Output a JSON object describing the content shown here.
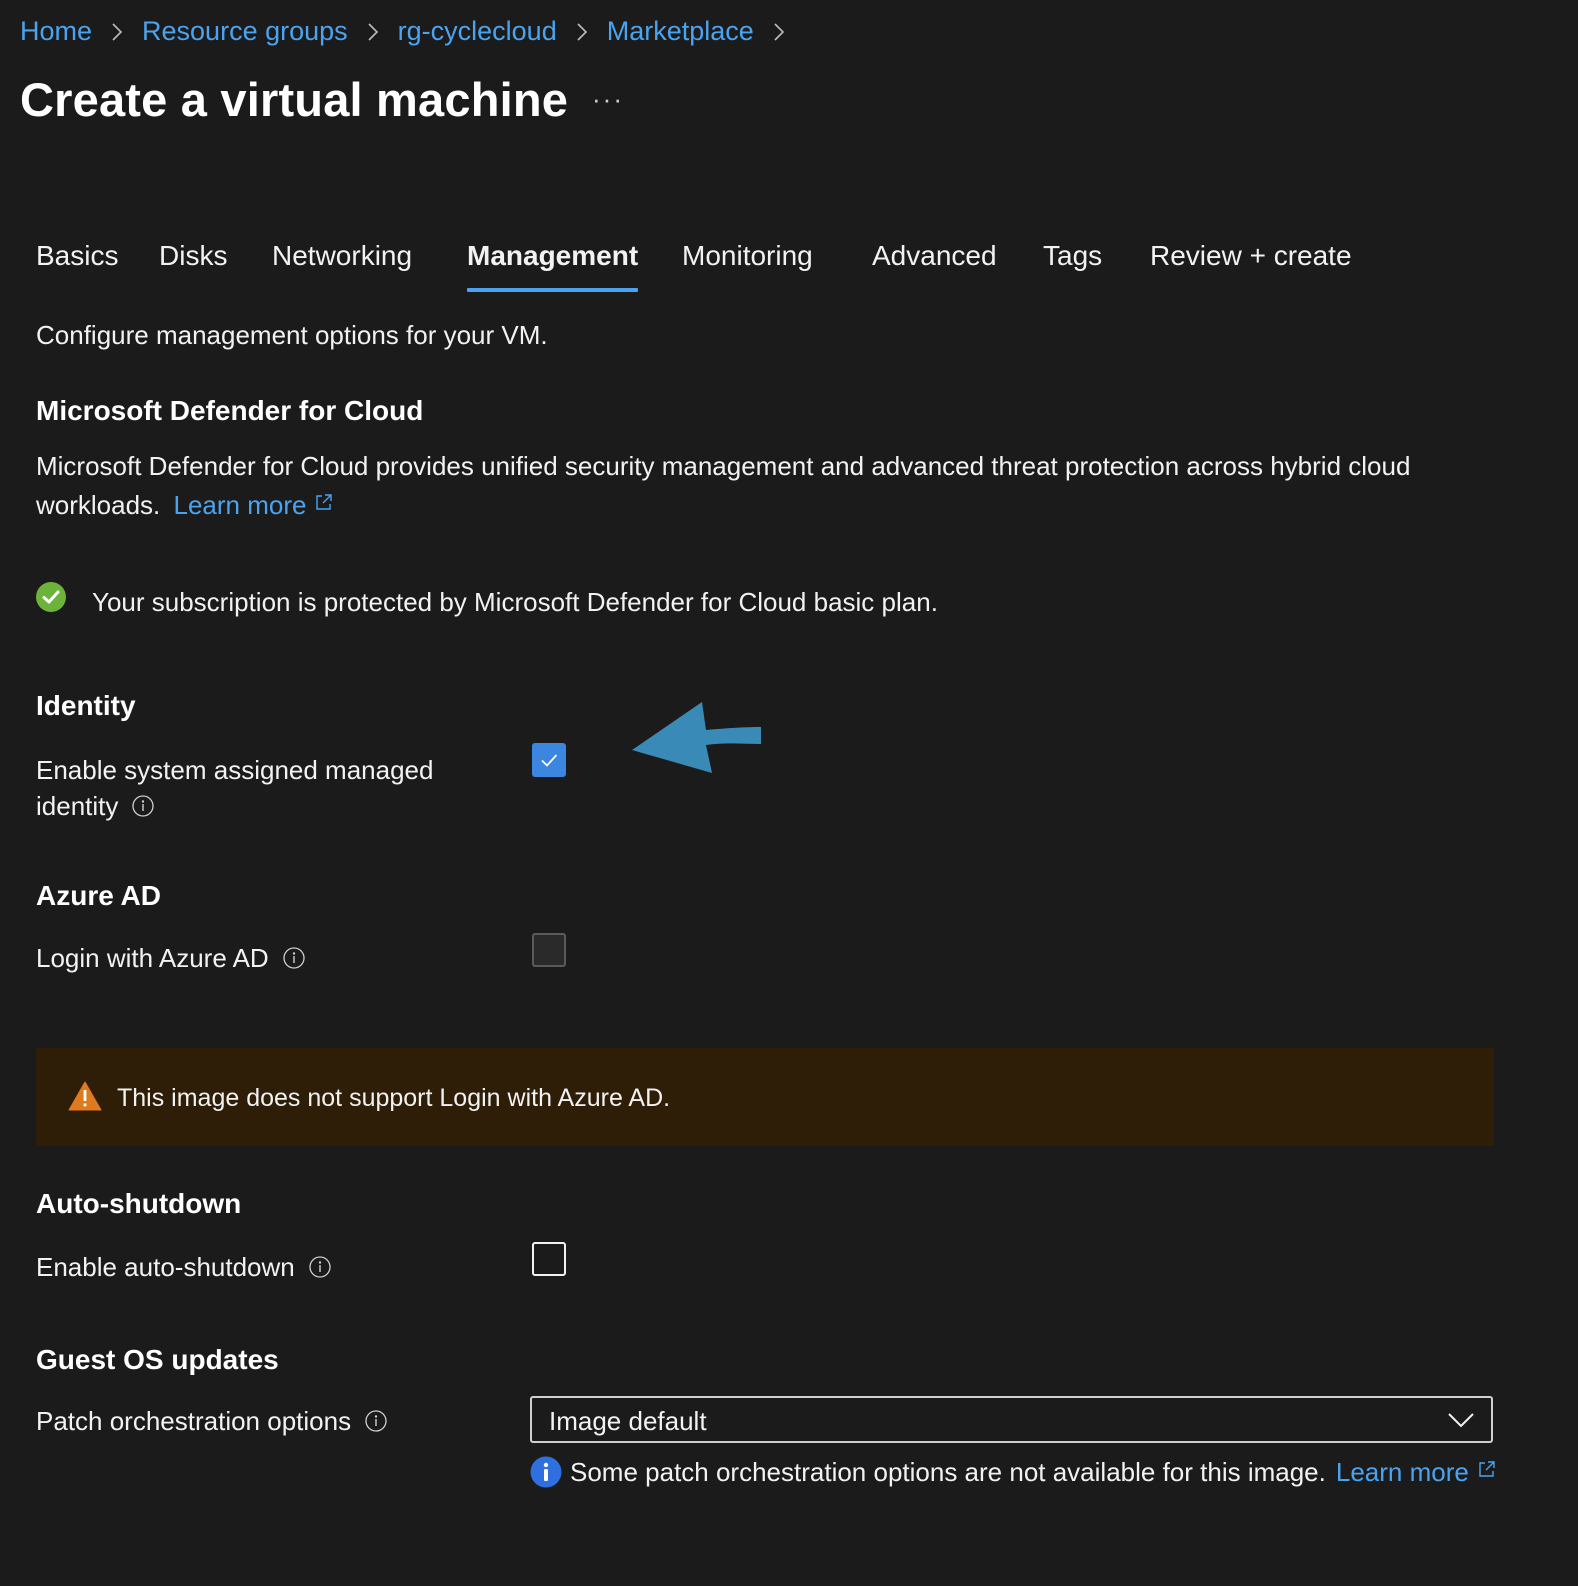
{
  "breadcrumb": {
    "items": [
      "Home",
      "Resource groups",
      "rg-cyclecloud",
      "Marketplace"
    ]
  },
  "page": {
    "title": "Create a virtual machine",
    "more_label": "···"
  },
  "tabs": [
    {
      "label": "Basics",
      "active": false
    },
    {
      "label": "Disks",
      "active": false
    },
    {
      "label": "Networking",
      "active": false
    },
    {
      "label": "Management",
      "active": true
    },
    {
      "label": "Monitoring",
      "active": false
    },
    {
      "label": "Advanced",
      "active": false
    },
    {
      "label": "Tags",
      "active": false
    },
    {
      "label": "Review + create",
      "active": false
    }
  ],
  "intro": "Configure management options for your VM.",
  "defender": {
    "heading": "Microsoft Defender for Cloud",
    "description_line1": "Microsoft Defender for Cloud provides unified security management and advanced threat protection across hybrid cloud",
    "description_line2": "workloads.",
    "learn_more": "Learn more",
    "status": "Your subscription is protected by Microsoft Defender for Cloud basic plan."
  },
  "identity": {
    "heading": "Identity",
    "label_line1": "Enable system assigned managed",
    "label_line2": "identity",
    "checked": true
  },
  "azure_ad": {
    "heading": "Azure AD",
    "label": "Login with Azure AD",
    "checked": false,
    "disabled": true,
    "warning": "This image does not support Login with Azure AD."
  },
  "auto_shutdown": {
    "heading": "Auto-shutdown",
    "label": "Enable auto-shutdown",
    "checked": false
  },
  "guest_os": {
    "heading": "Guest OS updates",
    "label": "Patch orchestration options",
    "selected": "Image default",
    "note": "Some patch orchestration options are not available for this image.",
    "learn_more": "Learn more"
  },
  "colors": {
    "background": "#1b1b1b",
    "link": "#4ba3f0",
    "checkbox_checked": "#3b86e0",
    "success": "#6bb33a",
    "warning_bg": "#2e1d07",
    "warning_icon": "#e07a1f",
    "info_icon": "#2f6fe0",
    "annotation_arrow": "#3a8ab8"
  }
}
